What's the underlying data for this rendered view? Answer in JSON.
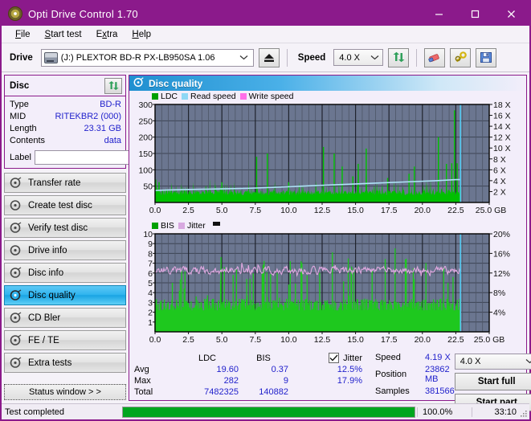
{
  "window": {
    "title": "Opti Drive Control 1.70",
    "icon": "disc-icon",
    "minimize": "—",
    "maximize": "□",
    "close": "✕"
  },
  "menu": [
    {
      "label": "File",
      "accel": "F"
    },
    {
      "label": "Start test",
      "accel": "S"
    },
    {
      "label": "Extra",
      "accel": "x"
    },
    {
      "label": "Help",
      "accel": "H"
    }
  ],
  "toolbar": {
    "drive_label": "Drive",
    "drive_value": "(J:) PLEXTOR BD-R  PX-LB950SA 1.06",
    "speed_label": "Speed",
    "speed_value": "4.0 X",
    "buttons": [
      {
        "name": "eject-icon"
      },
      {
        "name": "refresh-icon"
      },
      {
        "name": "eraser-icon"
      },
      {
        "name": "key-icon"
      },
      {
        "name": "save-icon"
      }
    ]
  },
  "disc": {
    "title": "Disc",
    "refresh_icon": "refresh-icon",
    "rows": [
      {
        "key": "Type",
        "value": "BD-R"
      },
      {
        "key": "MID",
        "value": "RITEKBR2 (000)"
      },
      {
        "key": "Length",
        "value": "23.31 GB"
      },
      {
        "key": "Contents",
        "value": "data"
      }
    ],
    "label_key": "Label",
    "label_value": "",
    "label_placeholder": ""
  },
  "sidebar": {
    "items": [
      {
        "label": "Transfer rate",
        "active": false
      },
      {
        "label": "Create test disc",
        "active": false
      },
      {
        "label": "Verify test disc",
        "active": false
      },
      {
        "label": "Drive info",
        "active": false
      },
      {
        "label": "Disc info",
        "active": false
      },
      {
        "label": "Disc quality",
        "active": true
      },
      {
        "label": "CD Bler",
        "active": false
      },
      {
        "label": "FE / TE",
        "active": false
      },
      {
        "label": "Extra tests",
        "active": false
      }
    ],
    "status_window": "Status window > >"
  },
  "panel": {
    "title": "Disc quality",
    "icon": "disc-quality-icon"
  },
  "stats": {
    "col_headers": [
      "LDC",
      "BIS"
    ],
    "jitter_label": "Jitter",
    "jitter_checked": true,
    "rows": [
      {
        "key": "Avg",
        "ldc": "19.60",
        "bis": "0.37",
        "jitter": "12.5%"
      },
      {
        "key": "Max",
        "ldc": "282",
        "bis": "9",
        "jitter": "17.9%"
      },
      {
        "key": "Total",
        "ldc": "7482325",
        "bis": "140882",
        "jitter": ""
      }
    ],
    "speed_key": "Speed",
    "speed_value": "4.19 X",
    "position_key": "Position",
    "position_value": "23862 MB",
    "samples_key": "Samples",
    "samples_value": "381566",
    "speed_select": "4.0 X",
    "start_full": "Start full",
    "start_part": "Start part"
  },
  "statusbar": {
    "text": "Test completed",
    "percent": "100.0%",
    "progress": 100,
    "time": "33:10"
  },
  "colors": {
    "ldc_green": "#00c000",
    "read_speed_blue": "#8fd8f5",
    "write_speed_pink": "#ff6ee8",
    "bis_green": "#1ec81e",
    "jitter_pink": "#e0a8e0",
    "plot_bg": "#5f6b85",
    "accent": "#8B1A8B",
    "value_blue": "#2222cc"
  },
  "chart_data": [
    {
      "type": "line",
      "id": "disc-quality-ldc-chart",
      "title": "",
      "legend": [
        {
          "label": "LDC",
          "color": "#00c000"
        },
        {
          "label": "Read speed",
          "color": "#8fd8f5"
        },
        {
          "label": "Write speed",
          "color": "#ff6ee8"
        }
      ],
      "legend_position": "top-left",
      "xlabel": "GB",
      "x_ticks": [
        "0.0",
        "2.5",
        "5.0",
        "7.5",
        "10.0",
        "12.5",
        "15.0",
        "17.5",
        "20.0",
        "22.5",
        "25.0 GB"
      ],
      "xlim": [
        0,
        25
      ],
      "ylabel_left": "LDC",
      "y_ticks_left": [
        "300",
        "250",
        "200",
        "150",
        "100",
        "50"
      ],
      "ylim_left": [
        0,
        300
      ],
      "ylabel_right": "Speed",
      "y_ticks_right": [
        "18 X",
        "16 X",
        "14 X",
        "12 X",
        "10 X",
        "8 X",
        "6 X",
        "4 X",
        "2 X"
      ],
      "ylim_right": [
        0,
        18
      ],
      "grid": true,
      "data_end_gb": 22.85,
      "series": [
        {
          "name": "LDC",
          "color": "#00c000",
          "kind": "spikes",
          "baseline": 22,
          "points": [
            [
              0.05,
              70
            ],
            [
              0.12,
              55
            ],
            [
              0.2,
              48
            ],
            [
              0.3,
              62
            ],
            [
              0.42,
              40
            ],
            [
              0.55,
              52
            ],
            [
              0.7,
              44
            ],
            [
              0.85,
              38
            ],
            [
              1.0,
              46
            ],
            [
              1.2,
              35
            ],
            [
              1.4,
              42
            ],
            [
              1.6,
              30
            ],
            [
              1.8,
              38
            ],
            [
              2.0,
              34
            ],
            [
              2.2,
              44
            ],
            [
              2.4,
              30
            ],
            [
              2.6,
              36
            ],
            [
              2.8,
              28
            ],
            [
              3.0,
              33
            ],
            [
              3.2,
              40
            ],
            [
              3.4,
              29
            ],
            [
              3.6,
              36
            ],
            [
              3.8,
              52
            ],
            [
              4.0,
              30
            ],
            [
              4.2,
              34
            ],
            [
              4.4,
              28
            ],
            [
              4.6,
              33
            ],
            [
              4.8,
              30
            ],
            [
              5.0,
              62
            ],
            [
              5.2,
              34
            ],
            [
              5.4,
              30
            ],
            [
              5.6,
              28
            ],
            [
              5.8,
              33
            ],
            [
              6.0,
              30
            ],
            [
              6.2,
              36
            ],
            [
              6.4,
              28
            ],
            [
              6.6,
              30
            ],
            [
              6.8,
              33
            ],
            [
              7.0,
              28
            ],
            [
              7.2,
              36
            ],
            [
              7.4,
              30
            ],
            [
              7.6,
              140
            ],
            [
              7.8,
              35
            ],
            [
              8.0,
              30
            ],
            [
              8.2,
              34
            ],
            [
              8.4,
              150
            ],
            [
              8.6,
              38
            ],
            [
              8.8,
              30
            ],
            [
              9.0,
              34
            ],
            [
              9.2,
              30
            ],
            [
              9.4,
              28
            ],
            [
              9.6,
              36
            ],
            [
              9.8,
              30
            ],
            [
              10.0,
              62
            ],
            [
              10.2,
              30
            ],
            [
              10.4,
              34
            ],
            [
              10.6,
              28
            ],
            [
              10.8,
              33
            ],
            [
              11.0,
              30
            ],
            [
              11.2,
              40
            ],
            [
              11.4,
              28
            ],
            [
              11.6,
              36
            ],
            [
              11.8,
              30
            ],
            [
              12.0,
              55
            ],
            [
              12.2,
              30
            ],
            [
              12.4,
              34
            ],
            [
              12.6,
              170
            ],
            [
              12.8,
              30
            ],
            [
              13.0,
              44
            ],
            [
              13.2,
              32
            ],
            [
              13.4,
              150
            ],
            [
              13.6,
              36
            ],
            [
              13.8,
              30
            ],
            [
              14.0,
              110
            ],
            [
              14.2,
              40
            ],
            [
              14.4,
              33
            ],
            [
              14.6,
              30
            ],
            [
              14.8,
              80
            ],
            [
              15.0,
              35
            ],
            [
              15.2,
              118
            ],
            [
              15.4,
              30
            ],
            [
              15.6,
              34
            ],
            [
              15.8,
              165
            ],
            [
              16.0,
              38
            ],
            [
              16.2,
              30
            ],
            [
              16.4,
              52
            ],
            [
              16.6,
              40
            ],
            [
              16.8,
              34
            ],
            [
              17.0,
              60
            ],
            [
              17.2,
              36
            ],
            [
              17.4,
              75
            ],
            [
              17.6,
              30
            ],
            [
              17.8,
              42
            ],
            [
              18.0,
              38
            ],
            [
              18.2,
              34
            ],
            [
              18.4,
              30
            ],
            [
              18.6,
              44
            ],
            [
              18.8,
              36
            ],
            [
              19.0,
              88
            ],
            [
              19.2,
              40
            ],
            [
              19.4,
              110
            ],
            [
              19.6,
              36
            ],
            [
              19.8,
              30
            ],
            [
              20.0,
              46
            ],
            [
              20.2,
              34
            ],
            [
              20.4,
              40
            ],
            [
              20.6,
              36
            ],
            [
              20.8,
              50
            ],
            [
              21.0,
              38
            ],
            [
              21.2,
              200
            ],
            [
              21.4,
              42
            ],
            [
              21.6,
              36
            ],
            [
              21.8,
              118
            ],
            [
              22.0,
              46
            ],
            [
              22.2,
              120
            ],
            [
              22.4,
              282
            ],
            [
              22.6,
              120
            ],
            [
              22.8,
              60
            ]
          ]
        },
        {
          "name": "Read speed",
          "color": "#8fd8f5",
          "kind": "line",
          "axis": "right",
          "points": [
            [
              0.0,
              2.2
            ],
            [
              1.0,
              2.3
            ],
            [
              3.0,
              2.4
            ],
            [
              5.0,
              2.5
            ],
            [
              7.0,
              2.6
            ],
            [
              9.0,
              2.8
            ],
            [
              11.0,
              3.0
            ],
            [
              13.0,
              3.2
            ],
            [
              15.0,
              3.4
            ],
            [
              17.0,
              3.6
            ],
            [
              19.0,
              3.8
            ],
            [
              21.0,
              4.0
            ],
            [
              22.5,
              4.19
            ],
            [
              22.85,
              4.19
            ]
          ]
        }
      ],
      "marker_line_gb": 22.85,
      "marker_color": "#55c8f0"
    },
    {
      "type": "line",
      "id": "disc-quality-bis-chart",
      "title": "",
      "legend": [
        {
          "label": "BIS",
          "color": "#1ec81e"
        },
        {
          "label": "Jitter",
          "color": "#e0a8e0"
        }
      ],
      "legend_position": "top-left",
      "xlabel": "GB",
      "x_ticks": [
        "0.0",
        "2.5",
        "5.0",
        "7.5",
        "10.0",
        "12.5",
        "15.0",
        "17.5",
        "20.0",
        "22.5",
        "25.0 GB"
      ],
      "xlim": [
        0,
        25
      ],
      "ylabel_left": "BIS",
      "y_ticks_left": [
        "10",
        "9",
        "8",
        "7",
        "6",
        "5",
        "4",
        "3",
        "2",
        "1"
      ],
      "ylim_left": [
        0,
        10
      ],
      "ylabel_right": "Jitter",
      "y_ticks_right": [
        "20%",
        "16%",
        "12%",
        "8%",
        "4%"
      ],
      "ylim_right": [
        0,
        20
      ],
      "grid": true,
      "data_end_gb": 22.85,
      "series": [
        {
          "name": "BIS",
          "color": "#1ec81e",
          "kind": "spikes",
          "baseline": 2.6,
          "avg": 0.37,
          "max": 9
        },
        {
          "name": "Jitter",
          "color": "#e0a8e0",
          "kind": "line",
          "axis": "right",
          "avg": 12.5,
          "max": 17.9,
          "band": [
            11.4,
            13.6
          ]
        }
      ],
      "marker_line_gb": 22.85,
      "marker_color": "#55c8f0"
    }
  ]
}
